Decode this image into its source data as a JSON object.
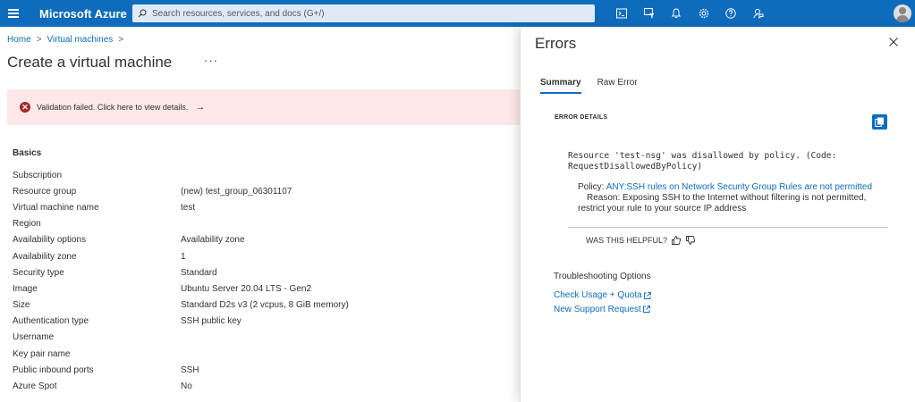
{
  "topbar": {
    "brand": "Microsoft Azure",
    "search_placeholder": "Search resources, services, and docs (G+/)",
    "icons": [
      "cloud-shell-icon",
      "directory-filter-icon",
      "notifications-icon",
      "settings-icon",
      "help-icon",
      "feedback-icon"
    ]
  },
  "breadcrumb": {
    "home": "Home",
    "virtual_machines": "Virtual machines",
    "separator": ">"
  },
  "page": {
    "title": "Create a virtual machine",
    "more": "···"
  },
  "validation": {
    "message": "Validation failed. Click here to view details.",
    "arrow": "→"
  },
  "basics": {
    "section_title": "Basics",
    "rows": [
      {
        "label": "Subscription",
        "value": ""
      },
      {
        "label": "Resource group",
        "value": "(new) test_group_06301107"
      },
      {
        "label": "Virtual machine name",
        "value": "test"
      },
      {
        "label": "Region",
        "value": ""
      },
      {
        "label": "Availability options",
        "value": "Availability zone"
      },
      {
        "label": "Availability zone",
        "value": "1"
      },
      {
        "label": "Security type",
        "value": "Standard"
      },
      {
        "label": "Image",
        "value": "Ubuntu Server 20.04 LTS - Gen2"
      },
      {
        "label": "Size",
        "value": "Standard D2s v3 (2 vcpus, 8 GiB memory)"
      },
      {
        "label": "Authentication type",
        "value": "SSH public key"
      },
      {
        "label": "Username",
        "value": ""
      },
      {
        "label": "Key pair name",
        "value": ""
      },
      {
        "label": "Public inbound ports",
        "value": "SSH"
      },
      {
        "label": "Azure Spot",
        "value": "No"
      }
    ]
  },
  "errors_panel": {
    "title": "Errors",
    "tabs": [
      "Summary",
      "Raw Error"
    ],
    "active_tab": "Summary",
    "details_label": "ERROR DETAILS",
    "message_line1": "Resource 'test-nsg' was disallowed by policy. (Code:",
    "message_line2": "RequestDisallowedByPolicy)",
    "policy_label": "Policy:",
    "policy_link": "ANY:SSH rules on Network Security Group Rules are not permitted",
    "reason": "Reason: Exposing SSH to the Internet without filtering is not permitted, restrict your rule to your source IP address",
    "helpful_label": "WAS THIS HELPFUL?",
    "troubleshooting_title": "Troubleshooting Options",
    "links": [
      "Check Usage + Quota",
      "New Support Request"
    ]
  },
  "colors": {
    "accent": "#0f6cbd",
    "error": "#a4262c",
    "error_bg": "#fde7e9"
  }
}
